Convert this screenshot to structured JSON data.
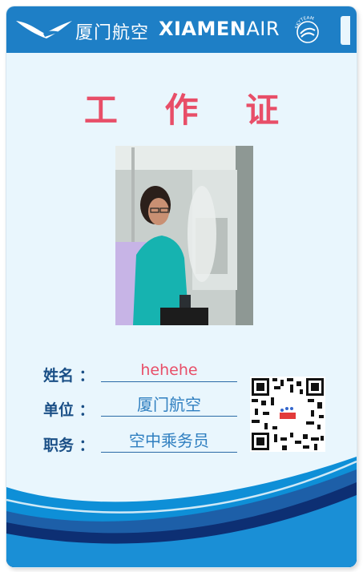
{
  "header": {
    "brand_cn": "厦门航空",
    "brand_en_bold": "XIAMEN",
    "brand_en_thin": "AIR",
    "logo": "egret-logo",
    "alliance_logo": "skyteam-logo",
    "alliance_text": "SKYTEAM"
  },
  "card": {
    "title": "工 作 证",
    "photo": "employee-photo",
    "fields": [
      {
        "label": "姓名 ：",
        "value": "hehehe"
      },
      {
        "label": "单位 ：",
        "value": "厦门航空"
      },
      {
        "label": "职务 ：",
        "value": "空中乘务员"
      }
    ],
    "qr": "qr-code"
  },
  "colors": {
    "brand_blue": "#1e7fc6",
    "title_red": "#e84e68",
    "label_navy": "#1a4f86",
    "value_blue": "#2f7fc0",
    "card_bg": "#e9f6fd"
  }
}
